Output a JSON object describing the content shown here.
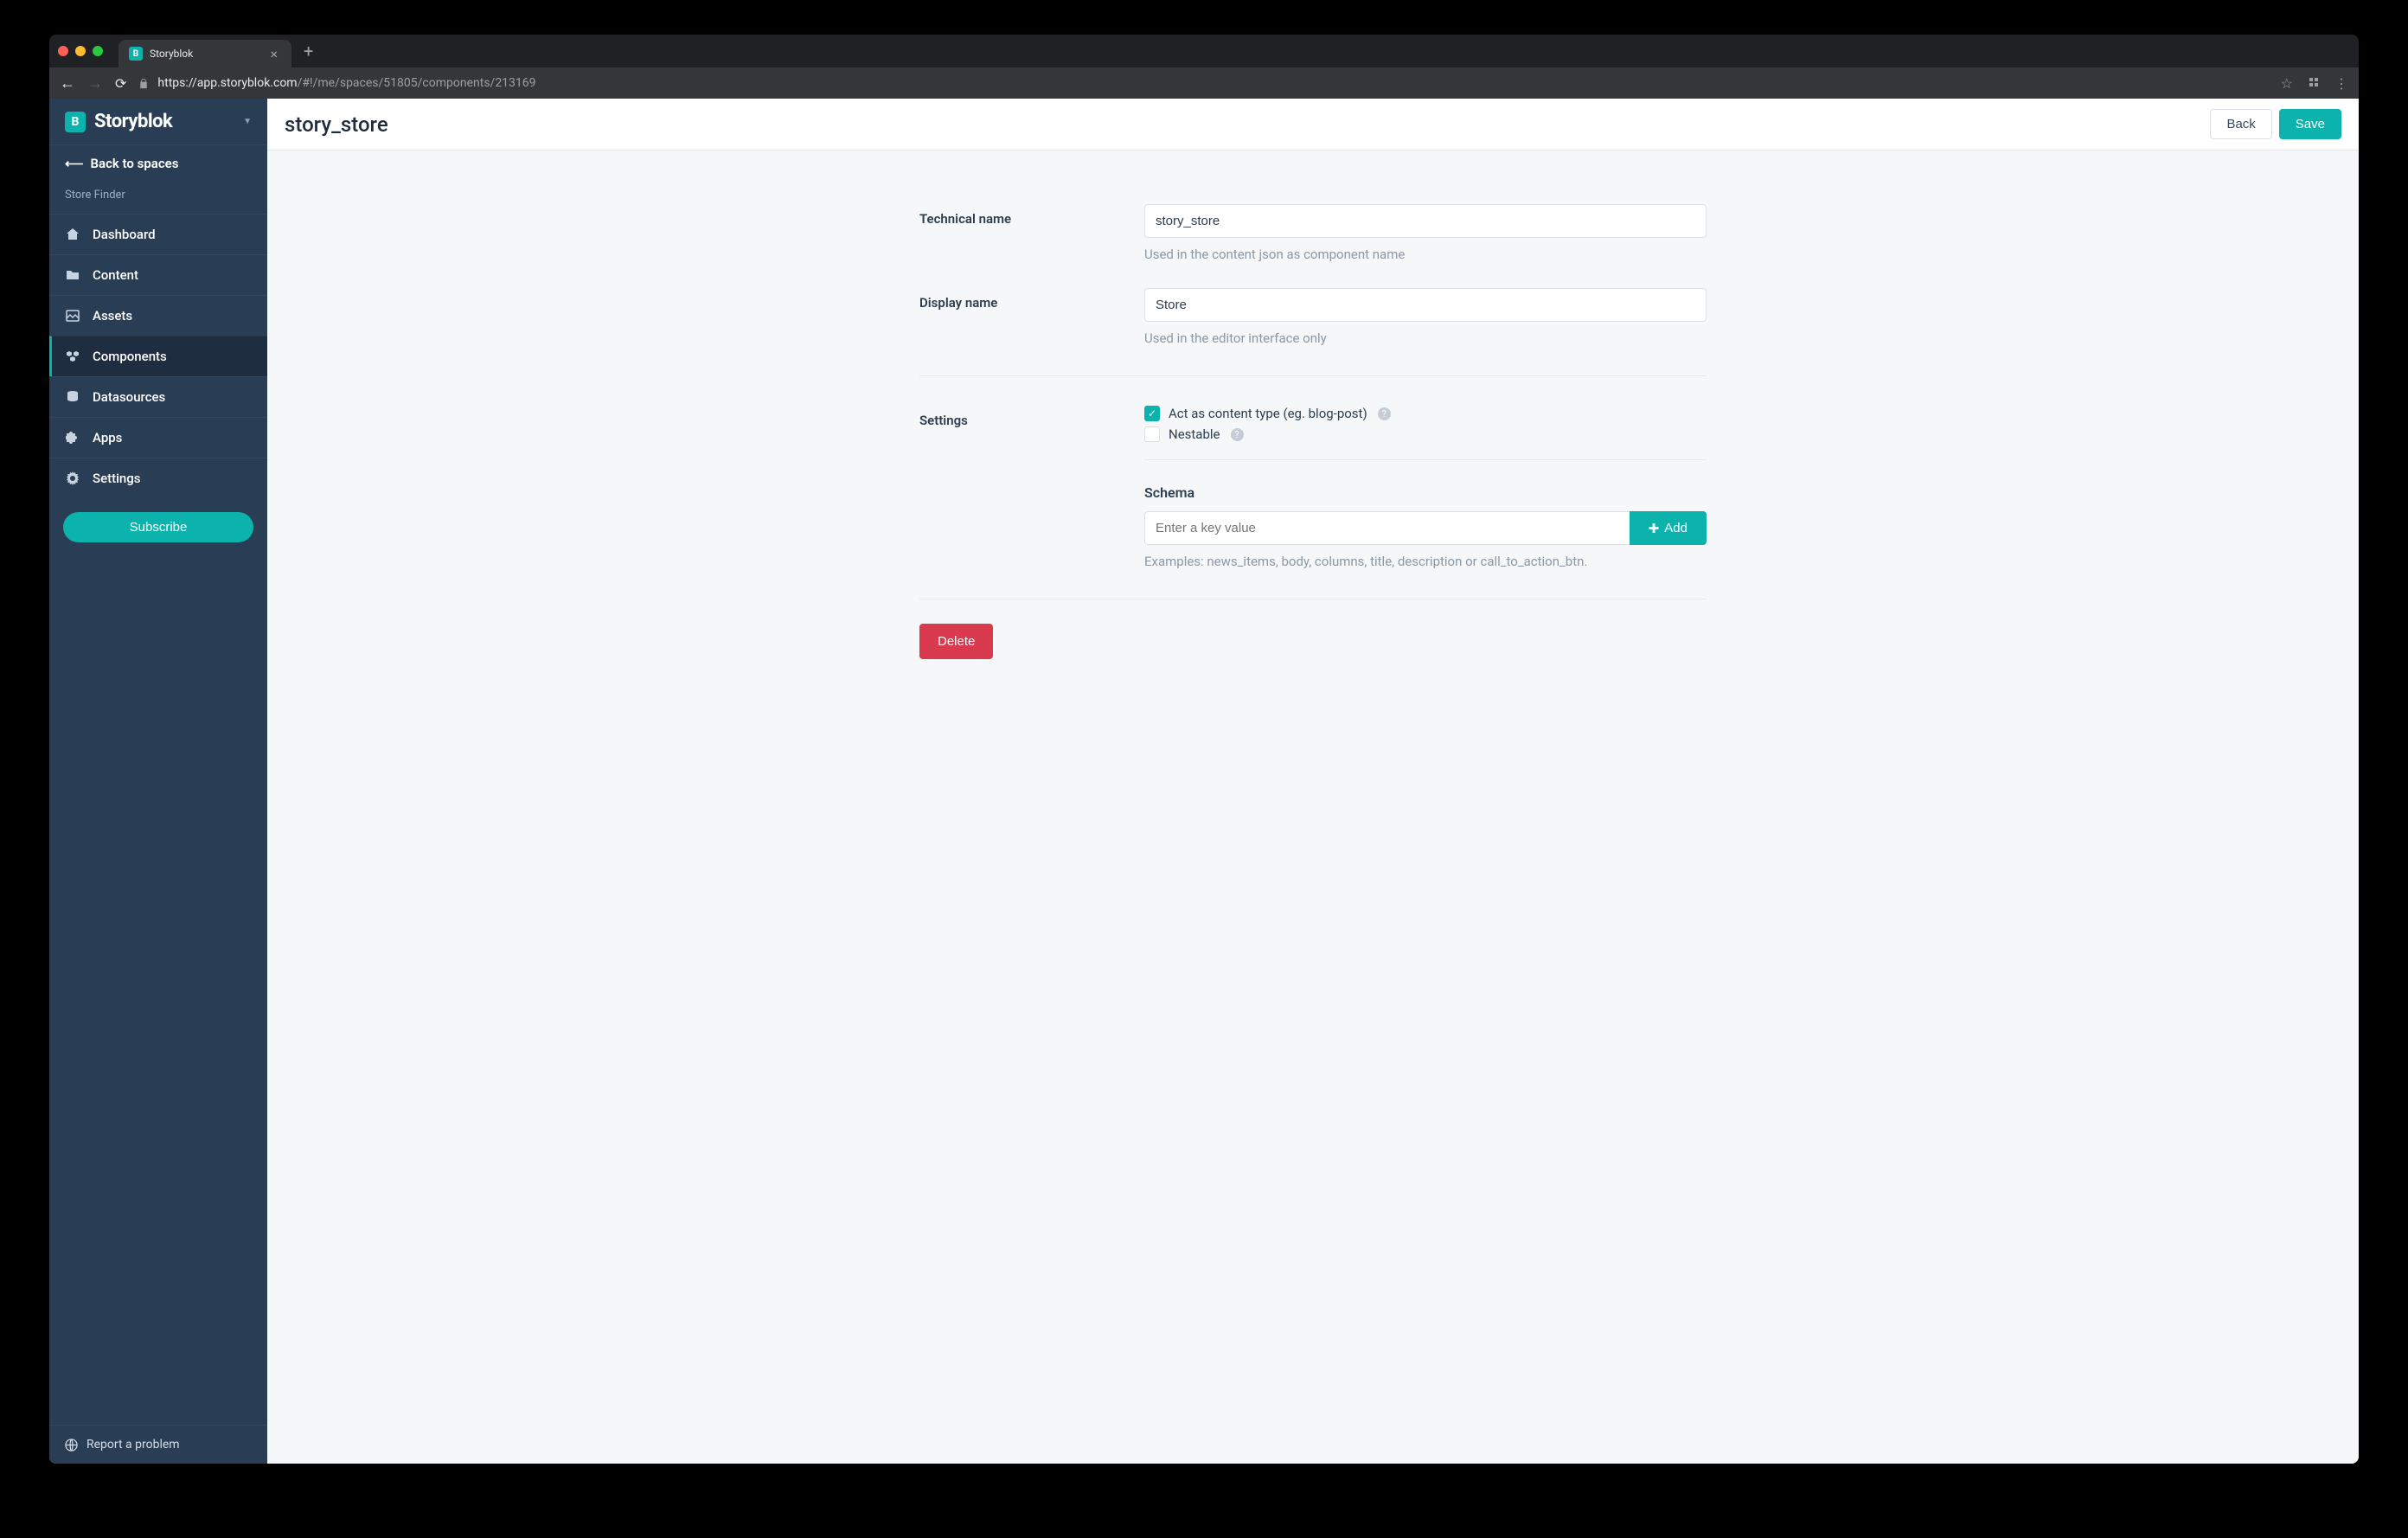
{
  "browser": {
    "tab_title": "Storyblok",
    "url_host": "https://app.storyblok.com",
    "url_path": "/#!/me/spaces/51805/components/213169"
  },
  "sidebar": {
    "brand": "Storyblok",
    "back_label": "Back to spaces",
    "space_name": "Store Finder",
    "items": [
      {
        "label": "Dashboard"
      },
      {
        "label": "Content"
      },
      {
        "label": "Assets"
      },
      {
        "label": "Components"
      },
      {
        "label": "Datasources"
      },
      {
        "label": "Apps"
      },
      {
        "label": "Settings"
      }
    ],
    "subscribe_label": "Subscribe",
    "report_label": "Report a problem"
  },
  "topbar": {
    "title": "story_store",
    "back_label": "Back",
    "save_label": "Save"
  },
  "form": {
    "technical_name": {
      "label": "Technical name",
      "value": "story_store",
      "help": "Used in the content json as component name"
    },
    "display_name": {
      "label": "Display name",
      "value": "Store",
      "help": "Used in the editor interface only"
    },
    "settings_label": "Settings",
    "content_type": {
      "checked": true,
      "label": "Act as content type (eg. blog-post)"
    },
    "nestable": {
      "checked": false,
      "label": "Nestable"
    },
    "schema": {
      "title": "Schema",
      "placeholder": "Enter a key value",
      "add_label": "Add",
      "examples": "Examples: news_items, body, columns, title, description or call_to_action_btn."
    },
    "delete_label": "Delete"
  }
}
